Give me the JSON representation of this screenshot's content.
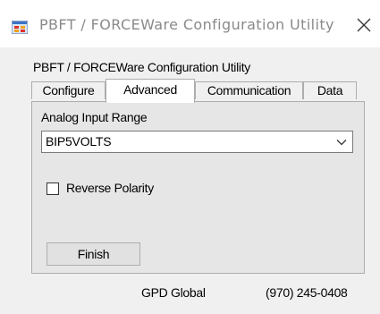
{
  "window": {
    "title": "PBFT / FORCEWare Configuration Utility"
  },
  "content": {
    "heading": "PBFT / FORCEWare Configuration Utility"
  },
  "tabs": [
    {
      "label": "Configure",
      "active": false
    },
    {
      "label": "Advanced",
      "active": true
    },
    {
      "label": "Communication",
      "active": false
    },
    {
      "label": "Data",
      "active": false
    }
  ],
  "advanced": {
    "analog_label": "Analog Input Range",
    "analog_value": "BIP5VOLTS",
    "reverse_polarity_label": "Reverse Polarity",
    "reverse_polarity_checked": false,
    "finish_label": "Finish"
  },
  "footer": {
    "company": "GPD Global",
    "phone": "(970) 245-0408"
  },
  "colors": {
    "window_bg": "#f0f0f0",
    "titlebar_bg": "#ffffff",
    "panel_bg": "#e6e6e6",
    "border": "#adadad",
    "title_text": "#8a8a8a"
  },
  "icons": {
    "app": "configuration-app-icon",
    "close": "close-icon",
    "dropdown": "chevron-down-icon"
  }
}
